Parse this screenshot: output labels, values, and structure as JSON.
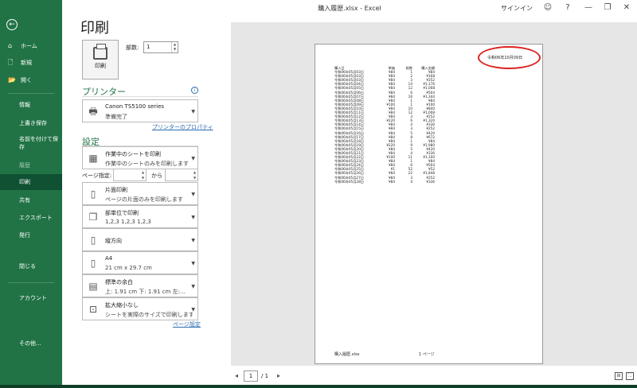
{
  "window": {
    "title": "購入履歴.xlsx  -  Excel",
    "signin": "サインイン",
    "icons": [
      "smiley-icon",
      "help-icon",
      "minimize-icon",
      "restore-icon",
      "close-icon"
    ],
    "help_glyph": "?",
    "minimize_glyph": "—",
    "restore_glyph": "❐",
    "close_glyph": "✕",
    "smiley_glyph": "☺"
  },
  "sidebar": {
    "back_glyph": "←",
    "items": [
      {
        "label": "ホーム",
        "icon": "⌂"
      },
      {
        "label": "新規",
        "icon": "🗋"
      },
      {
        "label": "開く",
        "icon": "📂"
      },
      {
        "label": "情報"
      },
      {
        "label": "上書き保存"
      },
      {
        "label": "名前を付けて保存"
      },
      {
        "label": "履歴"
      },
      {
        "label": "印刷"
      },
      {
        "label": "共有"
      },
      {
        "label": "エクスポート"
      },
      {
        "label": "発行"
      },
      {
        "label": "閉じる"
      },
      {
        "label": "アカウント"
      },
      {
        "label": "その他..."
      }
    ],
    "accent": "#217346"
  },
  "print": {
    "heading": "印刷",
    "print_button": "印刷",
    "copies_label": "部数:",
    "copies_value": "1"
  },
  "printer": {
    "section": "プリンター",
    "name": "Canon TS5100 series",
    "status": "準備完了",
    "properties_link": "プリンターのプロパティ"
  },
  "settings": {
    "section": "設定",
    "what": {
      "title": "作業中のシートを印刷",
      "desc": "作業中のシートのみを印刷します"
    },
    "pages_label": "ページ指定:",
    "pages_to": "から",
    "sides": {
      "title": "片面印刷",
      "desc": "ページの片面のみを印刷します"
    },
    "collate": {
      "title": "部単位で印刷",
      "desc": "1,2,3     1,2,3     1,2,3"
    },
    "orientation": {
      "title": "縦方向"
    },
    "paper": {
      "title": "A4",
      "desc": "21 cm x 29.7 cm"
    },
    "margins": {
      "title": "標準の余白",
      "desc": "上: 1.91 cm 下: 1.91 cm 左:..."
    },
    "scaling": {
      "title": "拡大縮小なし",
      "desc": "シートを実際のサイズで印刷します"
    },
    "page_setup_link": "ページ設定"
  },
  "preview": {
    "header_date": "令和06年10月09日",
    "columns": [
      "購入日",
      "単価",
      "枚数",
      "購入金額"
    ],
    "rows": [
      [
        "令和06年05月03日",
        "¥84",
        "1",
        "¥84"
      ],
      [
        "令和06年05月03日",
        "¥84",
        "2",
        "¥168"
      ],
      [
        "令和06年05月03日",
        "¥84",
        "3",
        "¥252"
      ],
      [
        "令和06年05月04日",
        "¥84",
        "14",
        "¥1,176"
      ],
      [
        "令和06年05月05日",
        "¥84",
        "12",
        "¥1,008"
      ],
      [
        "令和06年05月06日",
        "¥84",
        "6",
        "¥504"
      ],
      [
        "令和06年05月07日",
        "¥84",
        "16",
        "¥1,344"
      ],
      [
        "令和06年05月08日",
        "¥84",
        "1",
        "¥84"
      ],
      [
        "令和06年05月09日",
        "¥100",
        "1",
        "¥100"
      ],
      [
        "令和06年05月10日",
        "¥84",
        "10",
        "¥840"
      ],
      [
        "令和06年05月11日",
        "¥84",
        "12",
        "¥1,008"
      ],
      [
        "令和06年05月12日",
        "¥84",
        "3",
        "¥252"
      ],
      [
        "令和06年05月13日",
        "¥220",
        "6",
        "¥1,320"
      ],
      [
        "令和06年05月14日",
        "¥84",
        "4",
        "¥336"
      ],
      [
        "令和06年05月15日",
        "¥84",
        "3",
        "¥252"
      ],
      [
        "令和06年05月16日",
        "¥84",
        "5",
        "¥420"
      ],
      [
        "令和06年05月17日",
        "¥84",
        "8",
        "¥672"
      ],
      [
        "令和06年05月18日",
        "¥84",
        "1",
        "¥84"
      ],
      [
        "令和06年05月19日",
        "¥220",
        "9",
        "¥1,980"
      ],
      [
        "令和06年05月20日",
        "¥84",
        "5",
        "¥420"
      ],
      [
        "令和06年05月21日",
        "¥84",
        "4",
        "¥336"
      ],
      [
        "令和06年05月22日",
        "¥100",
        "11",
        "¥1,100"
      ],
      [
        "令和06年05月23日",
        "¥84",
        "1",
        "¥84"
      ],
      [
        "令和06年05月24日",
        "¥84",
        "6",
        "¥504"
      ],
      [
        "令和06年05月25日",
        "¥1",
        "52",
        "¥52"
      ],
      [
        "令和06年05月26日",
        "¥84",
        "22",
        "¥1,848"
      ],
      [
        "令和06年05月27日",
        "¥84",
        "3",
        "¥252"
      ],
      [
        "令和06年05月28日",
        "¥84",
        "4",
        "¥336"
      ]
    ],
    "footer_file": "購入履歴.xlsx",
    "footer_page": "1 ページ",
    "annotation_color": "#dd2222"
  },
  "page_nav": {
    "prev_glyph": "◂",
    "next_glyph": "▸",
    "current": "1",
    "total": "/ 1",
    "show_margins_glyph": "⊞",
    "zoom_page_glyph": "⛶"
  }
}
